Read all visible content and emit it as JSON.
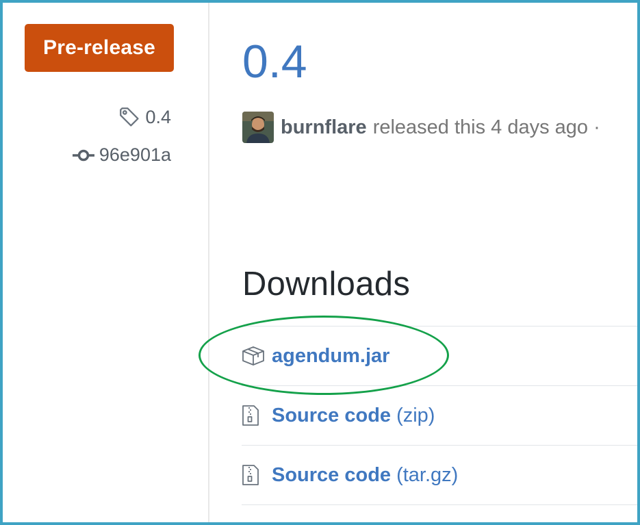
{
  "sidebar": {
    "badge_label": "Pre-release",
    "tag": {
      "icon": "tag-icon",
      "value": "0.4"
    },
    "commit": {
      "icon": "commit-icon",
      "value": "96e901a"
    }
  },
  "release": {
    "title": "0.4",
    "author": "burnflare",
    "released_text": "released this 4 days ago ·"
  },
  "downloads": {
    "heading": "Downloads",
    "items": [
      {
        "icon": "package-icon",
        "name": "agendum.jar",
        "ext": ""
      },
      {
        "icon": "file-zip-icon",
        "name": "Source code",
        "ext": "(zip)"
      },
      {
        "icon": "file-zip-icon",
        "name": "Source code",
        "ext": "(tar.gz)"
      }
    ]
  },
  "colors": {
    "frame_border": "#3fa3c4",
    "badge_bg": "#cb4f0d",
    "link_blue": "#4078c0",
    "annotation_green": "#14a14a"
  }
}
